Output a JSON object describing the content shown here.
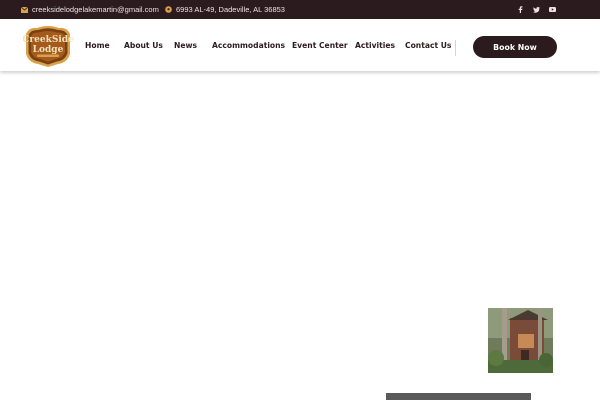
{
  "topbar": {
    "email": "creeksidelodgelakemartin@gmail.com",
    "address": "6993 AL-49, Dadeville, AL 36853",
    "icons": [
      "envelope-icon",
      "location-icon"
    ],
    "social": [
      "facebook-icon",
      "twitter-icon",
      "youtube-icon"
    ]
  },
  "logo": {
    "text_line1": "CreekSide",
    "text_line2": "Lodge"
  },
  "nav": {
    "items": [
      {
        "label": "Home"
      },
      {
        "label": "About Us"
      },
      {
        "label": "News"
      },
      {
        "label": "Accommodations"
      },
      {
        "label": "Event Center"
      },
      {
        "label": "Activities"
      },
      {
        "label": "Contact Us"
      }
    ]
  },
  "cta": {
    "label": "Book Now"
  },
  "colors": {
    "brand_dark": "#2b1b1f",
    "logo_brown": "#8a4a16",
    "logo_gold": "#d9a24a"
  }
}
